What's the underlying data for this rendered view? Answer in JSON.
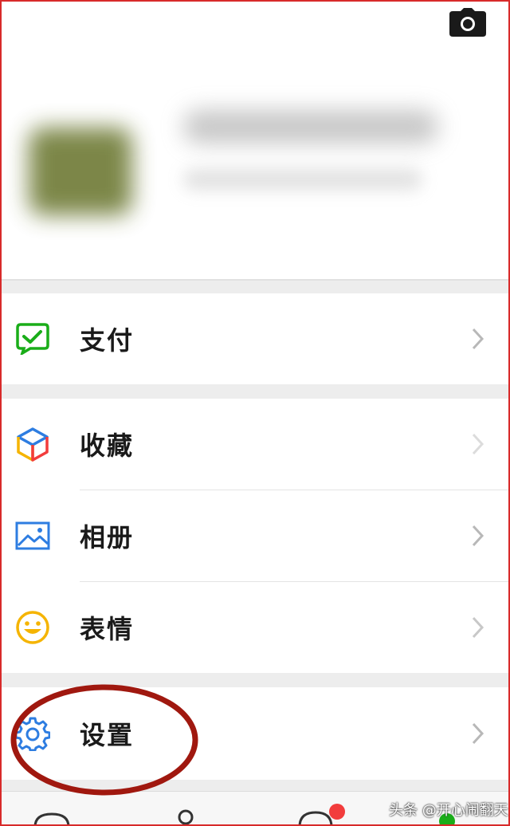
{
  "menu": {
    "pay_label": "支付",
    "favorites_label": "收藏",
    "album_label": "相册",
    "stickers_label": "表情",
    "settings_label": "设置"
  },
  "watermark": "头条 @开心闹翻天",
  "colors": {
    "pay_icon": "#1aad19",
    "album_icon": "#2e7de1",
    "sticker_icon": "#f5b400",
    "settings_icon": "#2e7de1",
    "annotation": "#a0180f",
    "notification_badge": "#f23c3c",
    "online_badge": "#1aad19"
  },
  "icons": {
    "camera": "camera-icon",
    "pay": "wallet-check-icon",
    "favorites": "cube-icon",
    "album": "image-icon",
    "stickers": "smiley-icon",
    "settings": "gear-icon",
    "chevron": "chevron-right-icon"
  }
}
